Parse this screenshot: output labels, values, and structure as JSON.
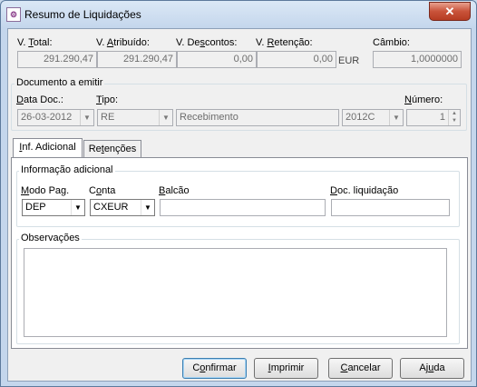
{
  "window": {
    "title": "Resumo de Liquidações",
    "close_glyph": "✕"
  },
  "summary": {
    "total_label_u": "V. ",
    "total_label_ul": "T",
    "total_label_rest": "otal:",
    "total_value": "291.290,47",
    "atrib_label_pre": "V. ",
    "atrib_label_ul": "A",
    "atrib_label_rest": "tribuído:",
    "atrib_value": "291.290,47",
    "desc_label_pre": "V. De",
    "desc_label_ul": "s",
    "desc_label_rest": "contos:",
    "desc_value": "0,00",
    "ret_label_pre": "V. ",
    "ret_label_ul": "R",
    "ret_label_rest": "etenção:",
    "ret_value": "0,00",
    "currency": "EUR",
    "cambio_label": "Câmbio:",
    "cambio_value": "1,0000000"
  },
  "documento": {
    "group_title": "Documento a emitir",
    "data_label_ul": "D",
    "data_label_rest": "ata Doc.:",
    "data_value": "26-03-2012",
    "tipo_label_ul": "T",
    "tipo_label_rest": "ipo:",
    "tipo_value": "RE",
    "tipo_desc": "Recebimento",
    "serie_value": "2012C",
    "numero_label_ul": "N",
    "numero_label_rest": "úmero:",
    "numero_value": "1"
  },
  "tabs": [
    {
      "label_ul": "I",
      "label_rest": "nf. Adicional"
    },
    {
      "label_pre": "Re",
      "label_ul": "t",
      "label_rest": "enções"
    }
  ],
  "info": {
    "group_title": "Informação adicional",
    "modo_label_ul": "M",
    "modo_label_rest": "odo Pag.",
    "modo_value": "DEP",
    "conta_label_pre": "C",
    "conta_label_ul": "o",
    "conta_label_rest": "nta",
    "conta_value": "CXEUR",
    "balcao_label_ul": "B",
    "balcao_label_rest": "alcão",
    "balcao_value": "",
    "docliq_label_ul": "D",
    "docliq_label_rest": "oc. liquidação",
    "docliq_value": ""
  },
  "observacoes": {
    "group_title": "Observações",
    "value": ""
  },
  "buttons": {
    "confirmar_pre": "C",
    "confirmar_ul": "o",
    "confirmar_rest": "nfirmar",
    "imprimir_ul": "I",
    "imprimir_rest": "mprimir",
    "cancelar_ul": "C",
    "cancelar_rest": "ancelar",
    "ajuda_pre": "Aj",
    "ajuda_ul": "u",
    "ajuda_rest": "da"
  },
  "icons": {
    "dropdown": "▼",
    "spin_up": "▲",
    "spin_down": "▼"
  }
}
